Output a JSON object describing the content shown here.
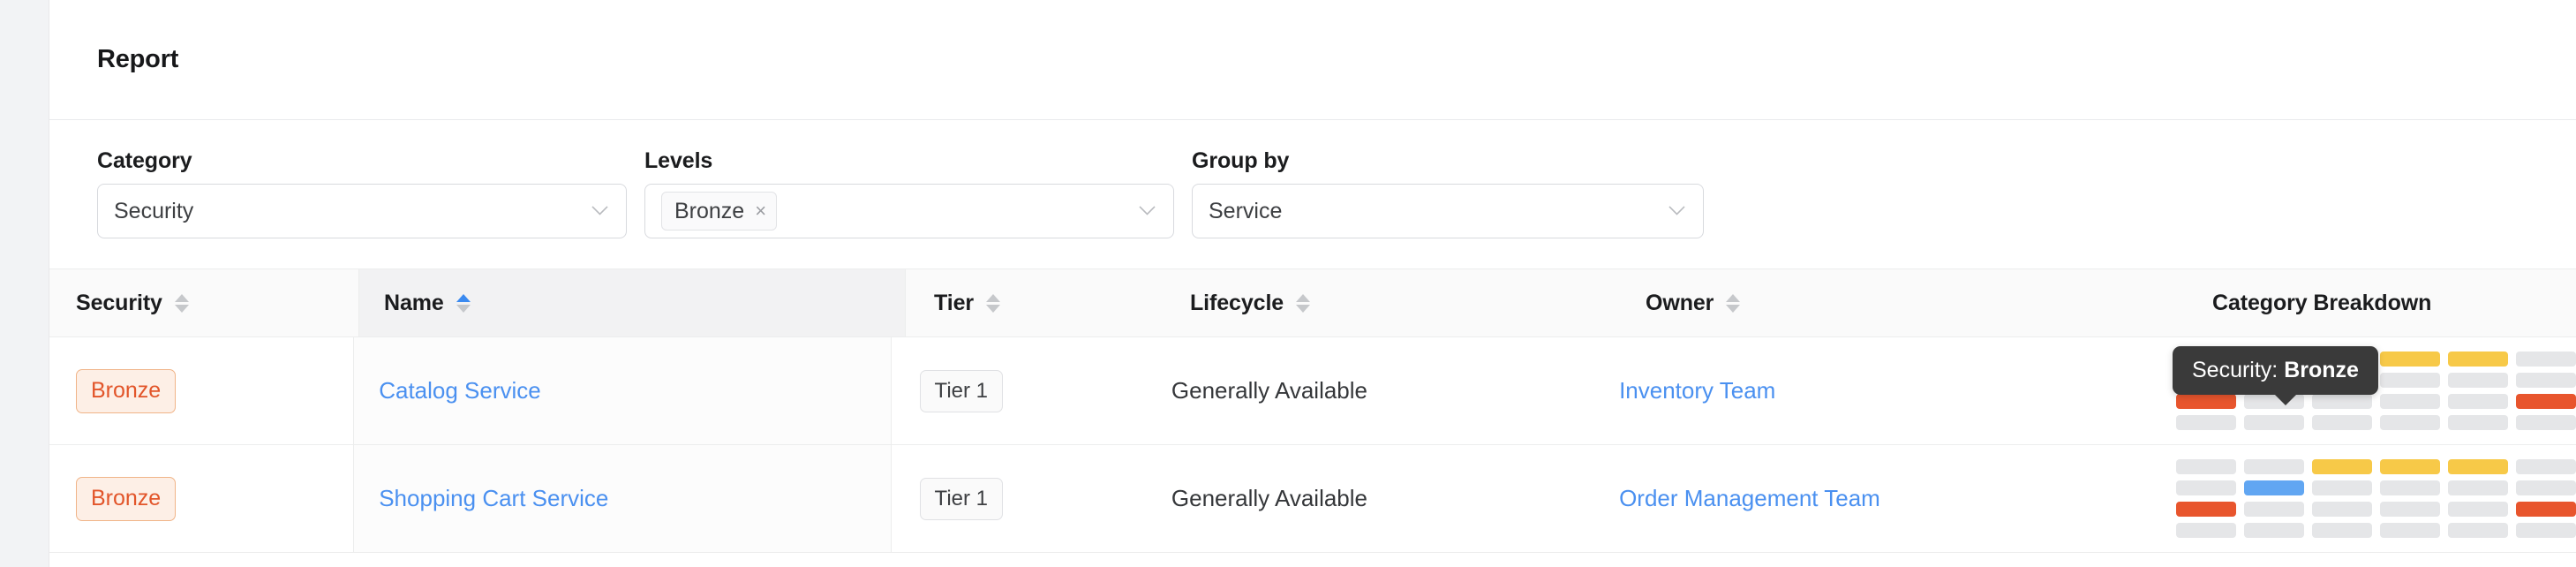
{
  "header": {
    "title": "Report"
  },
  "filters": [
    {
      "label": "Category",
      "value": "Security",
      "type": "select"
    },
    {
      "label": "Levels",
      "value": "",
      "chips": [
        "Bronze"
      ],
      "type": "multiselect"
    },
    {
      "label": "Group by",
      "value": "Service",
      "type": "select"
    }
  ],
  "filter_labels": {
    "category": "Category",
    "levels": "Levels",
    "group_by": "Group by"
  },
  "filter_values": {
    "category": "Security",
    "levels_chip": "Bronze",
    "levels_chip_remove": "×",
    "group_by": "Service"
  },
  "table": {
    "columns": [
      {
        "label": "Security",
        "sortable": true,
        "sort": "none"
      },
      {
        "label": "Name",
        "sortable": true,
        "sort": "asc"
      },
      {
        "label": "Tier",
        "sortable": true,
        "sort": "none"
      },
      {
        "label": "Lifecycle",
        "sortable": true,
        "sort": "none"
      },
      {
        "label": "Owner",
        "sortable": true,
        "sort": "none"
      },
      {
        "label": "Category Breakdown",
        "sortable": false,
        "sort": "none"
      }
    ],
    "rows": [
      {
        "security": "Bronze",
        "name": "Catalog Service",
        "tier": "Tier 1",
        "lifecycle": "Generally Available",
        "owner": "Inventory Team",
        "breakdown": [
          [
            "gray",
            "gray",
            "yellow",
            "yellow",
            "yellow",
            "gray"
          ],
          [
            "gray",
            "gray",
            "gray",
            "gray",
            "gray",
            "gray"
          ],
          [
            "orange",
            "gray",
            "gray",
            "gray",
            "gray",
            "orange"
          ],
          [
            "gray",
            "gray",
            "gray",
            "gray",
            "gray",
            "gray"
          ]
        ]
      },
      {
        "security": "Bronze",
        "name": "Shopping Cart Service",
        "tier": "Tier 1",
        "lifecycle": "Generally Available",
        "owner": "Order Management Team",
        "breakdown": [
          [
            "gray",
            "gray",
            "yellow",
            "yellow",
            "yellow",
            "gray"
          ],
          [
            "gray",
            "blue",
            "gray",
            "gray",
            "gray",
            "gray"
          ],
          [
            "orange",
            "gray",
            "gray",
            "gray",
            "gray",
            "orange"
          ],
          [
            "gray",
            "gray",
            "gray",
            "gray",
            "gray",
            "gray"
          ]
        ]
      }
    ]
  },
  "tooltip": {
    "prefix": "Security: ",
    "value": "Bronze"
  },
  "colors": {
    "accent_link": "#4a90f0",
    "bronze_text": "#e2552a",
    "bronze_bg": "#fdefe6",
    "bronze_border": "#f0b488",
    "heat_gray": "#e5e6e8",
    "heat_yellow": "#f7c948",
    "heat_blue": "#61a6f2",
    "heat_orange": "#e8552d",
    "sort_active": "#3b8af0",
    "tooltip_bg": "#3a3a3a"
  }
}
